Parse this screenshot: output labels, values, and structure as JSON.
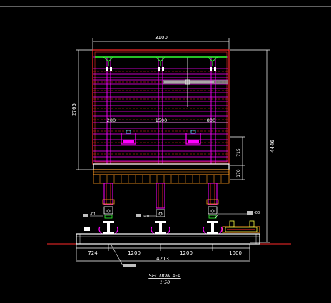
{
  "drawing": {
    "top_dimension": "3100",
    "left_height_dimension": "2765",
    "right_height_dimension": "4446",
    "right_small_dimension_upper": "715",
    "right_small_dimension_lower": "170",
    "inner_dimensions": [
      "280",
      "1500",
      "800"
    ],
    "bottom_dimensions": [
      "724",
      "1200",
      "1200",
      "1000"
    ],
    "bottom_total_dimension": "4213",
    "title": "SECTION A-A",
    "scale": "1:50",
    "callout_left_1": "-01",
    "callout_left_2": "-01",
    "callout_right": "-03"
  },
  "colors": {
    "background": "#000000",
    "magenta": "#ff00ff",
    "red": "#ff2a2a",
    "green": "#33ff33",
    "orange": "#ff9a1f",
    "yellow": "#ffff40",
    "white": "#ffffff",
    "cyan": "#33e0ff"
  }
}
